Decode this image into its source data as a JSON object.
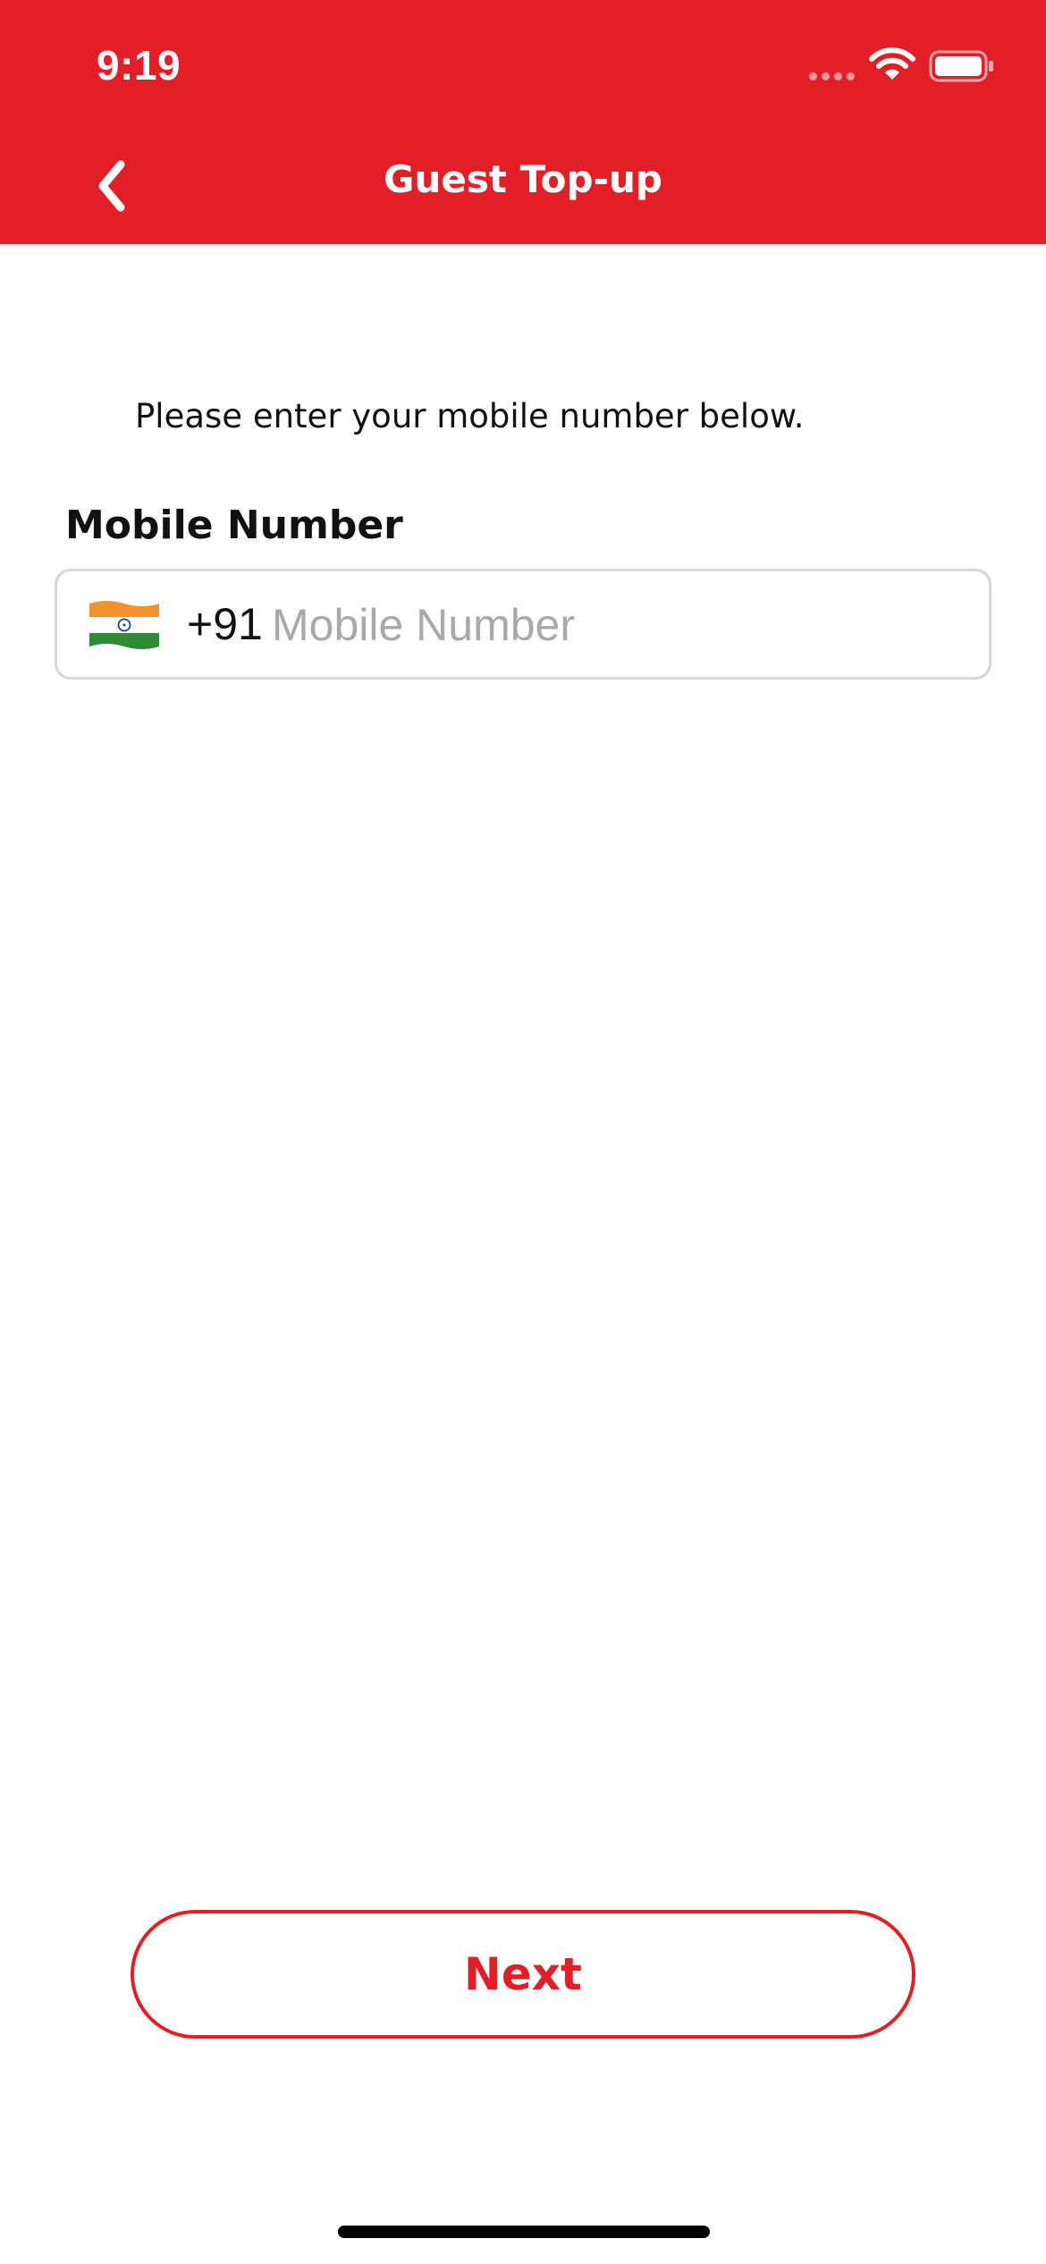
{
  "status_bar": {
    "time": "9:19",
    "icons": [
      "signal-icon",
      "wifi-icon",
      "battery-icon"
    ]
  },
  "header": {
    "title": "Guest Top-up",
    "back_icon": "chevron-left-icon",
    "background_color": "#e21e26"
  },
  "form": {
    "instruction": "Please enter your mobile number below.",
    "mobile_label": "Mobile Number",
    "country_flag_icon": "india-flag-icon",
    "dial_code": "+91",
    "mobile_value": "",
    "mobile_placeholder": "Mobile Number"
  },
  "actions": {
    "next_label": "Next",
    "accent_color": "#e21e26"
  }
}
